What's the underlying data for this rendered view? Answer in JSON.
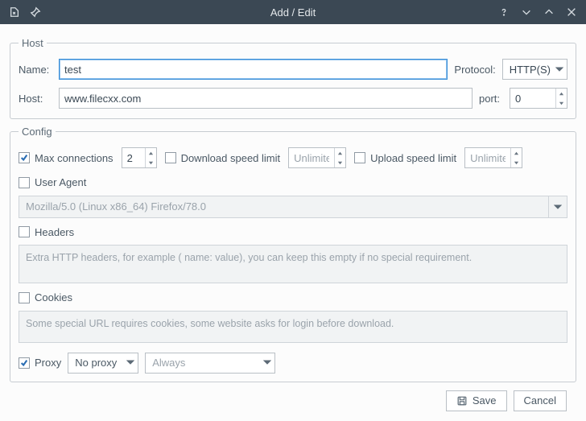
{
  "window": {
    "title": "Add / Edit"
  },
  "host_group": {
    "legend": "Host",
    "name_label": "Name:",
    "name_value": "test",
    "protocol_label": "Protocol:",
    "protocol_value": "HTTP(S)",
    "host_label": "Host:",
    "host_value": "www.filecxx.com",
    "port_label": "port:",
    "port_value": "0"
  },
  "config_group": {
    "legend": "Config",
    "max_conn": {
      "label": "Max connections",
      "value": "2",
      "checked": true
    },
    "dl_limit": {
      "label": "Download speed limit",
      "value": "Unlimited",
      "checked": false
    },
    "ul_limit": {
      "label": "Upload speed limit",
      "value": "Unlimited",
      "checked": false
    },
    "user_agent": {
      "label": "User Agent",
      "value": "Mozilla/5.0 (Linux x86_64) Firefox/78.0",
      "checked": false
    },
    "headers": {
      "label": "Headers",
      "placeholder": "Extra HTTP headers, for example ( name: value), you can keep this empty if no special requirement.",
      "checked": false
    },
    "cookies": {
      "label": "Cookies",
      "placeholder": "Some special URL requires cookies, some website asks for login before download.",
      "checked": false
    },
    "proxy": {
      "label": "Proxy",
      "value": "No proxy",
      "mode": "Always",
      "checked": true
    }
  },
  "buttons": {
    "save": "Save",
    "cancel": "Cancel"
  }
}
